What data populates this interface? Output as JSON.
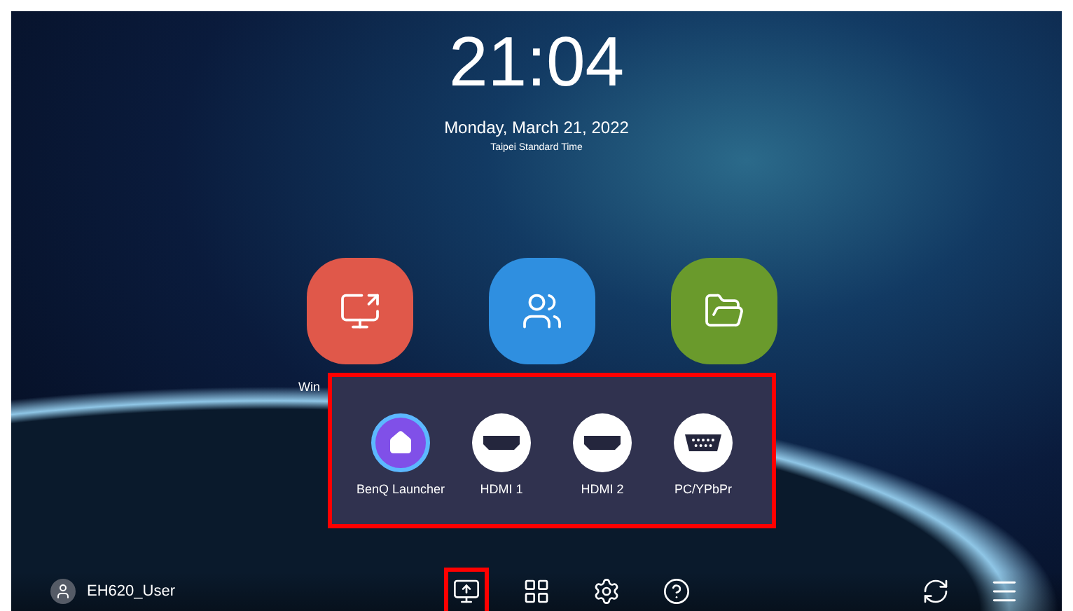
{
  "clock": {
    "time": "21:04",
    "date": "Monday, March 21, 2022",
    "timezone": "Taipei Standard Time"
  },
  "apps": [
    {
      "kind": "cast",
      "color": "#e0584a",
      "label": "Win"
    },
    {
      "kind": "media",
      "color": "#2f8fe0"
    },
    {
      "kind": "files",
      "color": "#6a9a2c"
    }
  ],
  "source_popup": {
    "highlighted": true,
    "sources": [
      {
        "kind": "home",
        "label": "BenQ Launcher",
        "selected": true
      },
      {
        "kind": "hdmi",
        "label": "HDMI 1",
        "selected": false
      },
      {
        "kind": "hdmi",
        "label": "HDMI 2",
        "selected": false
      },
      {
        "kind": "vga",
        "label": "PC/YPbPr",
        "selected": false
      }
    ]
  },
  "bottom_bar": {
    "user": "EH620_User",
    "tools": [
      {
        "kind": "source",
        "highlighted": true
      },
      {
        "kind": "apps",
        "highlighted": false
      },
      {
        "kind": "settings",
        "highlighted": false
      },
      {
        "kind": "help",
        "highlighted": false
      }
    ],
    "right_tools": [
      {
        "kind": "refresh"
      },
      {
        "kind": "menu"
      }
    ]
  }
}
